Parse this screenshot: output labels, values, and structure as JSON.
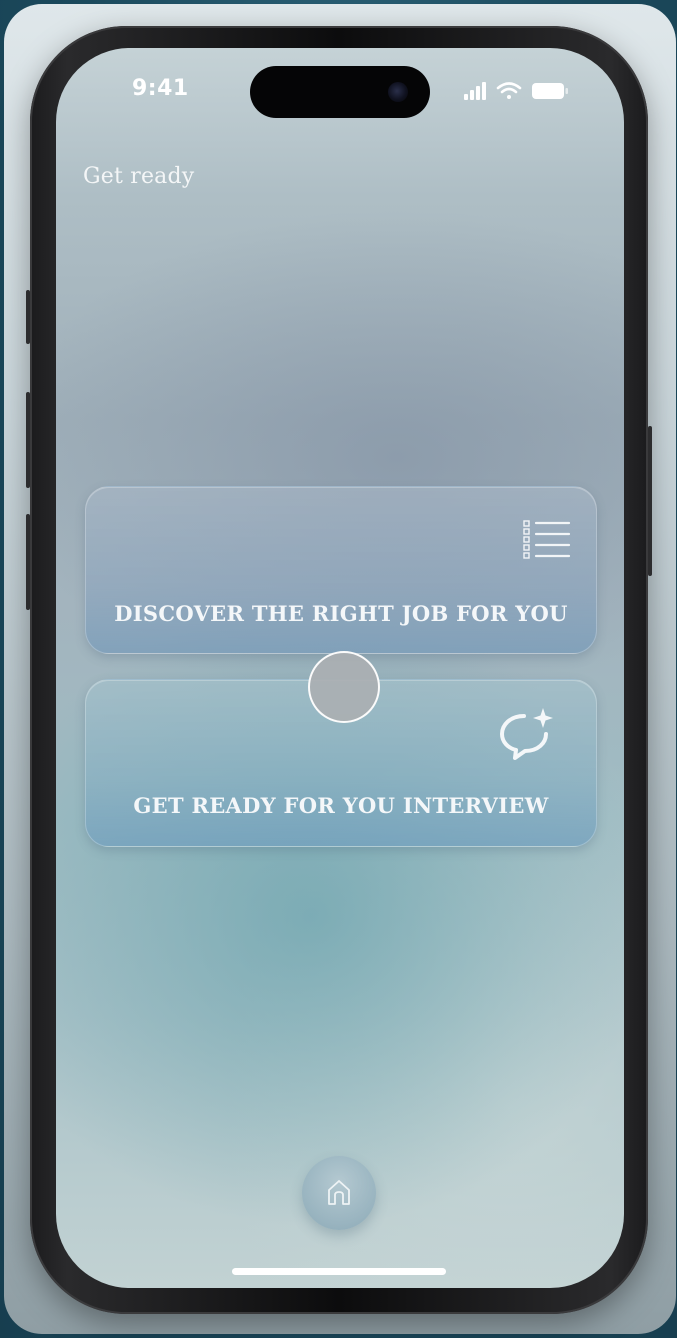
{
  "status_bar": {
    "time": "9:41",
    "signal_icon": "cellular-signal-icon",
    "wifi_icon": "wifi-icon",
    "battery_icon": "battery-icon"
  },
  "header": {
    "title": "Get ready"
  },
  "cards": [
    {
      "label": "DISCOVER THE RIGHT JOB FOR YOU",
      "icon": "checklist-icon"
    },
    {
      "label": "GET READY FOR YOU INTERVIEW",
      "icon": "chat-sparkle-icon"
    }
  ],
  "tab_bar": {
    "home_icon": "home-icon"
  },
  "colors": {
    "background": "#1e4a5c",
    "text": "#f4f7f9",
    "card_tint": "#8ba6be"
  }
}
